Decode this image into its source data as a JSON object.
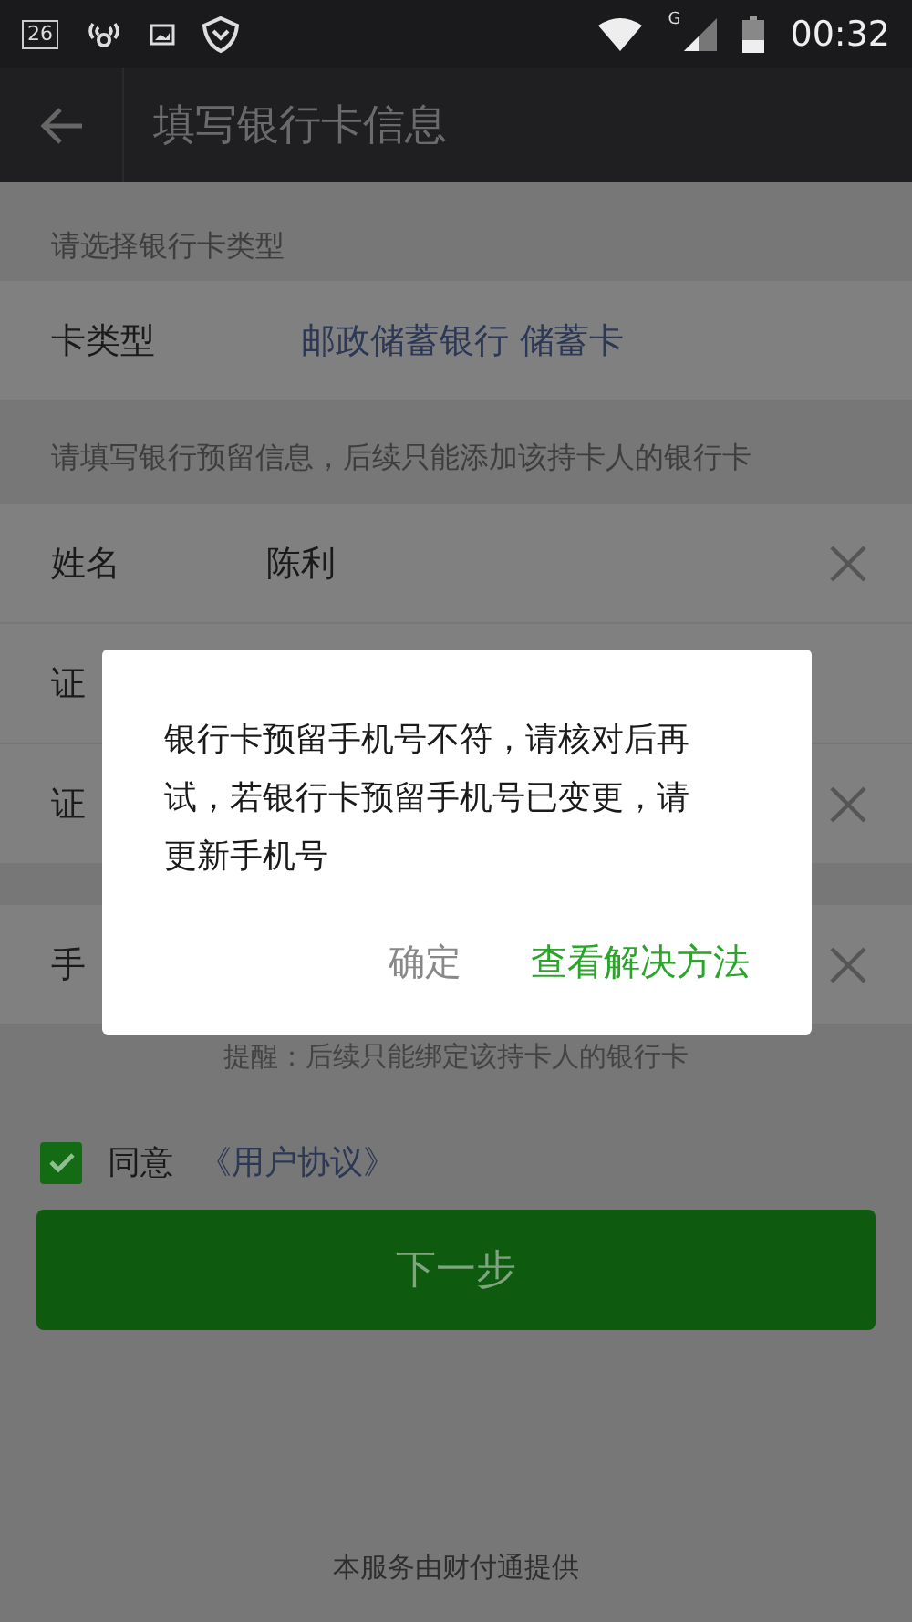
{
  "status_bar": {
    "notification_count": "26",
    "network_type": "G",
    "time": "00:32"
  },
  "title_bar": {
    "title": "填写银行卡信息"
  },
  "card_section": {
    "header": "请选择银行卡类型",
    "label": "卡类型",
    "value": "邮政储蓄银行 储蓄卡"
  },
  "info_section": {
    "header": "请填写银行预留信息，后续只能添加该持卡人的银行卡",
    "rows": [
      {
        "label": "姓名",
        "value": "陈利",
        "clear": true
      },
      {
        "label": "证",
        "clear": false
      },
      {
        "label": "证",
        "clear": true
      }
    ]
  },
  "phone_row": {
    "label": "手",
    "clear": true
  },
  "reminder": "提醒：后续只能绑定该持卡人的银行卡",
  "agreement": {
    "checked": true,
    "label": "同意",
    "link": "《用户协议》"
  },
  "next_button": "下一步",
  "footer": "本服务由财付通提供",
  "dialog": {
    "message": "银行卡预留手机号不符，请核对后再试，若银行卡预留手机号已变更，请更新手机号",
    "buttons": [
      {
        "label": "确定",
        "kind": "secondary"
      },
      {
        "label": "查看解决方法",
        "kind": "primary"
      }
    ]
  }
}
